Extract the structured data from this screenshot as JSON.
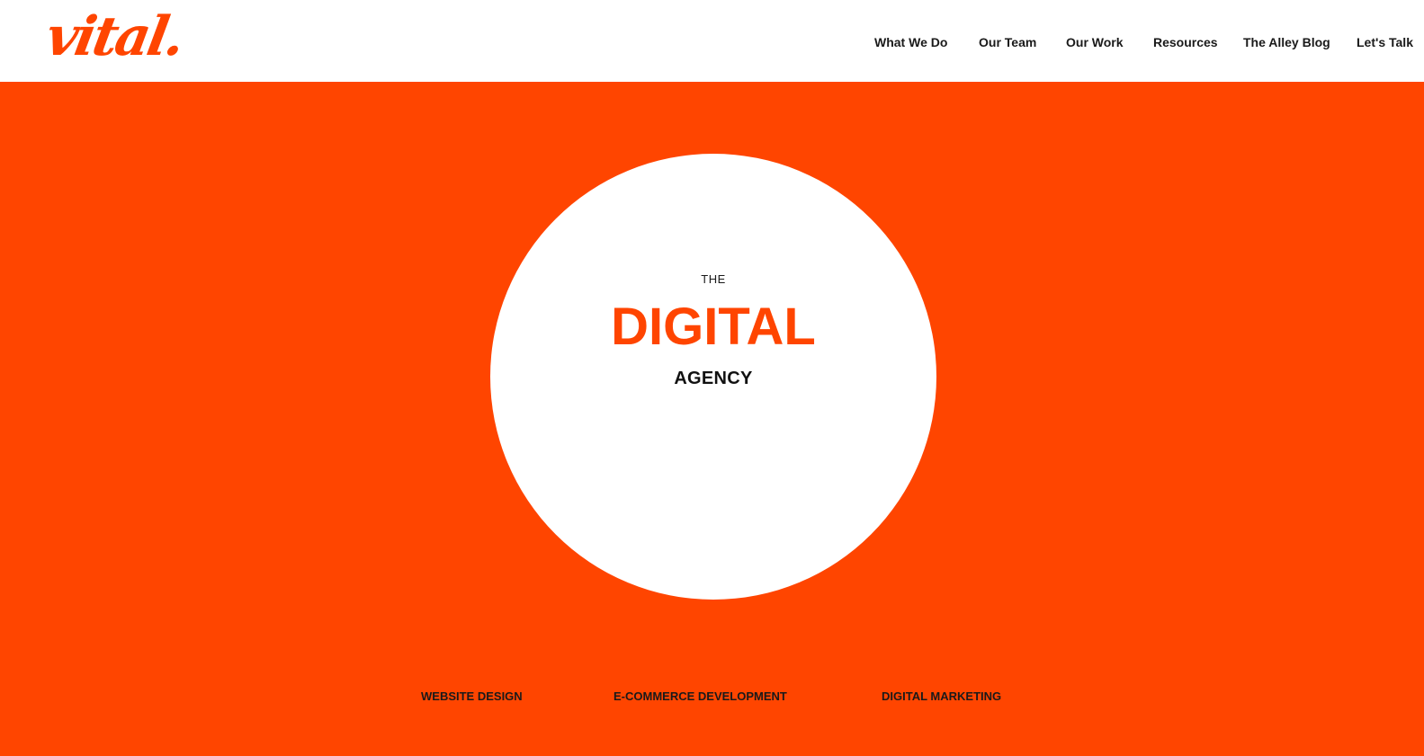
{
  "brand": {
    "logo_text": "vital.",
    "accent_color": "#ff4500",
    "header_bg": "#ffffff",
    "text_color": "#1a1a1a"
  },
  "nav": {
    "items": [
      {
        "label": "What We Do"
      },
      {
        "label": "Our Team"
      },
      {
        "label": "Our Work"
      },
      {
        "label": "Resources"
      },
      {
        "label": "The Alley Blog"
      },
      {
        "label": "Let's Talk"
      }
    ]
  },
  "hero": {
    "pre_title": "THE",
    "title": "DIGITAL",
    "subtitle": "AGENCY"
  },
  "services": [
    {
      "label": "WEBSITE DESIGN"
    },
    {
      "label": "E-COMMERCE DEVELOPMENT"
    },
    {
      "label": "DIGITAL MARKETING"
    }
  ]
}
